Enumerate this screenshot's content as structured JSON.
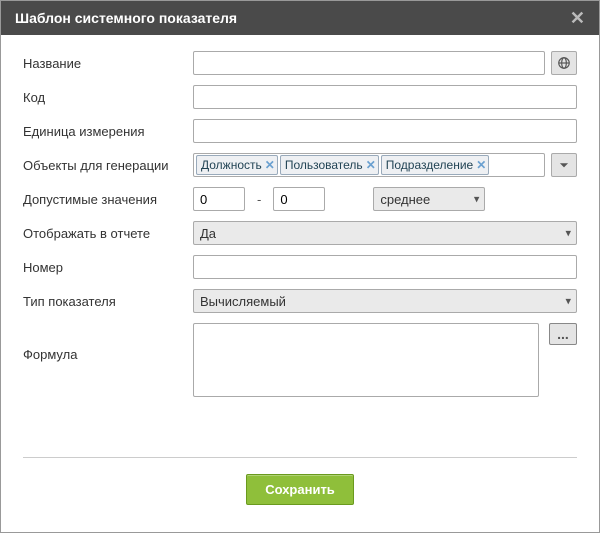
{
  "dialog": {
    "title": "Шаблон системного показателя"
  },
  "labels": {
    "name": "Название",
    "code": "Код",
    "unit": "Единица измерения",
    "objects": "Объекты для генерации",
    "allowed": "Допустимые значения",
    "show_in_report": "Отображать в отчете",
    "number": "Номер",
    "indicator_type": "Тип показателя",
    "formula": "Формула"
  },
  "values": {
    "name": "",
    "code": "",
    "unit": "",
    "allowed_min": "0",
    "allowed_max": "0",
    "aggregation": "среднее",
    "show_in_report": "Да",
    "number": "",
    "indicator_type": "Вычисляемый",
    "formula": ""
  },
  "tags": [
    {
      "label": "Должность"
    },
    {
      "label": "Пользователь"
    },
    {
      "label": "Подразделение"
    }
  ],
  "buttons": {
    "save": "Сохранить",
    "range_sep": "-",
    "ellipsis": "..."
  }
}
